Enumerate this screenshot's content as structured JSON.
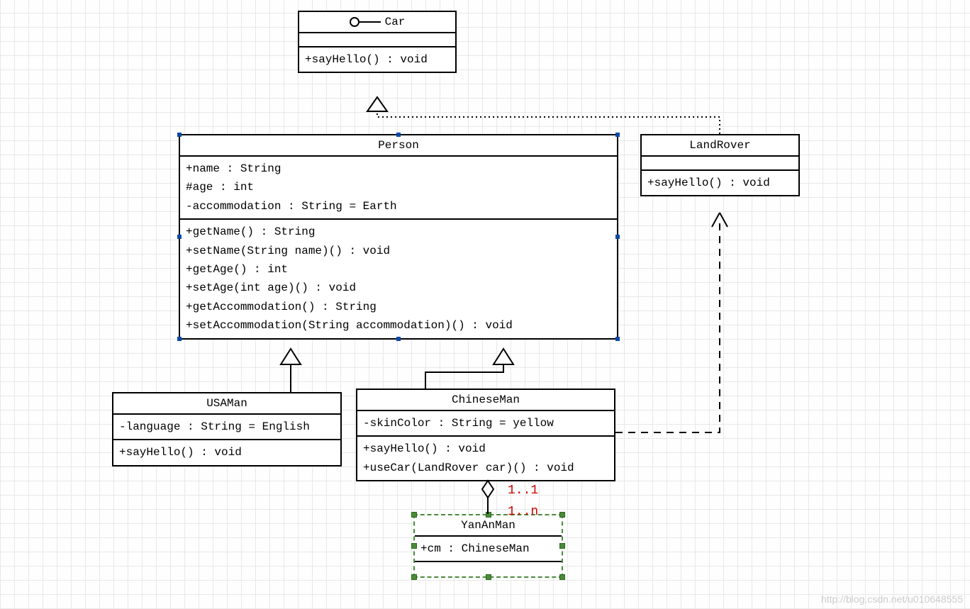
{
  "watermark": "http://blog.csdn.net/u010648555",
  "classes": {
    "car": {
      "name": "Car",
      "ops": [
        "+sayHello() : void"
      ]
    },
    "person": {
      "name": "Person",
      "attrs": [
        "+name : String",
        "#age : int",
        "-accommodation : String = Earth"
      ],
      "ops": [
        "+getName() : String",
        "+setName(String name)() : void",
        "+getAge() : int",
        "+setAge(int age)() : void",
        "+getAccommodation() : String",
        "+setAccommodation(String accommodation)() : void"
      ]
    },
    "landrover": {
      "name": "LandRover",
      "ops": [
        "+sayHello() : void"
      ]
    },
    "usaman": {
      "name": "USAMan",
      "attrs": [
        "-language : String = English"
      ],
      "ops": [
        "+sayHello() : void"
      ]
    },
    "chineseman": {
      "name": "ChineseMan",
      "attrs": [
        "-skinColor : String = yellow"
      ],
      "ops": [
        "+sayHello() : void",
        "+useCar(LandRover car)() : void"
      ]
    },
    "yananman": {
      "name": "YanAnMan",
      "attrs": [
        "+cm : ChineseMan"
      ]
    }
  },
  "multiplicities": {
    "top": "1..1",
    "bottom": "1..n"
  },
  "chart_data": {
    "type": "uml-class-diagram",
    "classes": [
      {
        "name": "Car",
        "stereotype": "interface",
        "attributes": [],
        "operations": [
          "+sayHello() : void"
        ]
      },
      {
        "name": "Person",
        "attributes": [
          "+name : String",
          "#age : int",
          "-accommodation : String = Earth"
        ],
        "operations": [
          "+getName() : String",
          "+setName(String name)() : void",
          "+getAge() : int",
          "+setAge(int age)() : void",
          "+getAccommodation() : String",
          "+setAccommodation(String accommodation)() : void"
        ]
      },
      {
        "name": "LandRover",
        "attributes": [],
        "operations": [
          "+sayHello() : void"
        ]
      },
      {
        "name": "USAMan",
        "attributes": [
          "-language : String = English"
        ],
        "operations": [
          "+sayHello() : void"
        ]
      },
      {
        "name": "ChineseMan",
        "attributes": [
          "-skinColor : String = yellow"
        ],
        "operations": [
          "+sayHello() : void",
          "+useCar(LandRover car)() : void"
        ]
      },
      {
        "name": "YanAnMan",
        "attributes": [
          "+cm : ChineseMan"
        ],
        "operations": []
      }
    ],
    "relationships": [
      {
        "from": "LandRover",
        "to": "Car",
        "type": "realization"
      },
      {
        "from": "USAMan",
        "to": "Person",
        "type": "generalization"
      },
      {
        "from": "ChineseMan",
        "to": "Person",
        "type": "generalization"
      },
      {
        "from": "ChineseMan",
        "to": "LandRover",
        "type": "dependency"
      },
      {
        "from": "YanAnMan",
        "to": "ChineseMan",
        "type": "aggregation",
        "multiplicity": {
          "from": "1..n",
          "to": "1..1"
        }
      }
    ]
  }
}
